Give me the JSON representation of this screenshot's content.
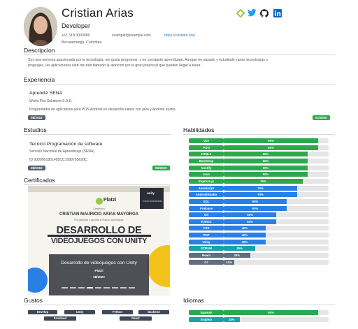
{
  "profile": {
    "name": "Cristian Arias",
    "role": "Developer",
    "phone": "+57 318 0000000",
    "email": "example@example.com",
    "website": "https://cristiam.site/",
    "address": "Bucaramanga, Colombia."
  },
  "social_icons": [
    "platzi-icon",
    "twitter-icon",
    "github-icon",
    "linkedin-icon"
  ],
  "colors": {
    "green": "#2ea84c",
    "blue": "#2a7fe4",
    "teal": "#1aa0b0",
    "slate": "#5f6e80",
    "twitter": "#1da1f2",
    "linkedin": "#0a66c2"
  },
  "sections": {
    "description": "Descripcion",
    "experience": "Experiencia",
    "studies": "Estudios",
    "skills": "Habilidades",
    "certificates": "Certificados",
    "likes": "Gustos",
    "languages": "Idiomas"
  },
  "description_lines": [
    "Soy una persona apasionada por la tecnología, me gusta programar, y en constante aprendizaje. Aunque he pasado y estudiado varias tecnologías o",
    "lenguajes, las aplicaciones web me han llamado la atención por el gran potencial que pueden llegar a tener."
  ],
  "experience": {
    "title": "Aprendiz SENA",
    "company": "World Pos Solutions S.A.S.",
    "detail": "Programador de aplicativos para POS Android en desarrollo nativo con java y Android studio.",
    "start": "08/2019",
    "end": "01/2020"
  },
  "study": {
    "title": "Tecnico Programación de software",
    "institution": "Servicio Nacional de Aprendizaje (SENA)",
    "id_line": "ID 9309001801495CC1098765628C",
    "start": "08/2019",
    "end": "05/2020"
  },
  "skills": [
    {
      "name": "Vue",
      "percent": 90,
      "color": "green"
    },
    {
      "name": "POO",
      "percent": 90,
      "color": "green"
    },
    {
      "name": "HTML5",
      "percent": 80,
      "color": "green"
    },
    {
      "name": "Bootstrap",
      "percent": 80,
      "color": "green"
    },
    {
      "name": "Vuetify",
      "percent": 80,
      "color": "green"
    },
    {
      "name": "Java",
      "percent": 80,
      "color": "green"
    },
    {
      "name": "Express.js",
      "percent": 75,
      "color": "green"
    },
    {
      "name": "JavaScript",
      "percent": 70,
      "color": "blue"
    },
    {
      "name": "AndroidStudio",
      "percent": 70,
      "color": "blue"
    },
    {
      "name": "SQL",
      "percent": 60,
      "color": "blue"
    },
    {
      "name": "Firebase",
      "percent": 60,
      "color": "blue"
    },
    {
      "name": "Git",
      "percent": 50,
      "color": "blue"
    },
    {
      "name": "Python",
      "percent": 50,
      "color": "blue"
    },
    {
      "name": "CSS",
      "percent": 40,
      "color": "blue"
    },
    {
      "name": "PHP",
      "percent": 40,
      "color": "blue"
    },
    {
      "name": "Unity",
      "percent": 40,
      "color": "blue"
    },
    {
      "name": "SCRUM",
      "percent": 30,
      "color": "teal"
    },
    {
      "name": "React",
      "percent": 25,
      "color": "slate"
    },
    {
      "name": "C#",
      "percent": 10,
      "color": "slate"
    }
  ],
  "certificate": {
    "caption": "Desarrollo de videojuegos con Unity",
    "issuer": "Platzi",
    "date": "08/2020",
    "image": {
      "brand": "Platzi",
      "partner": "unity",
      "partner_tag": "Curso Autorizado",
      "small_heading": "Certifica a",
      "student": "CRISTIAN MAURICIO ARIAS MAYORGA",
      "small_line": "Por participar y aprobar la Ruta de Aprendizaje",
      "headline_1": "DESARROLLO DE",
      "headline_2": "VIDEOJUEGOS CON UNITY"
    }
  },
  "likes": [
    [
      "Develop",
      "Unity",
      "Python",
      "Backend"
    ],
    [
      "Frontend",
      "React"
    ]
  ],
  "languages": [
    {
      "name": "Spanish",
      "percent": 90,
      "color": "green"
    },
    {
      "name": "English",
      "percent": 15,
      "color": "teal"
    }
  ]
}
